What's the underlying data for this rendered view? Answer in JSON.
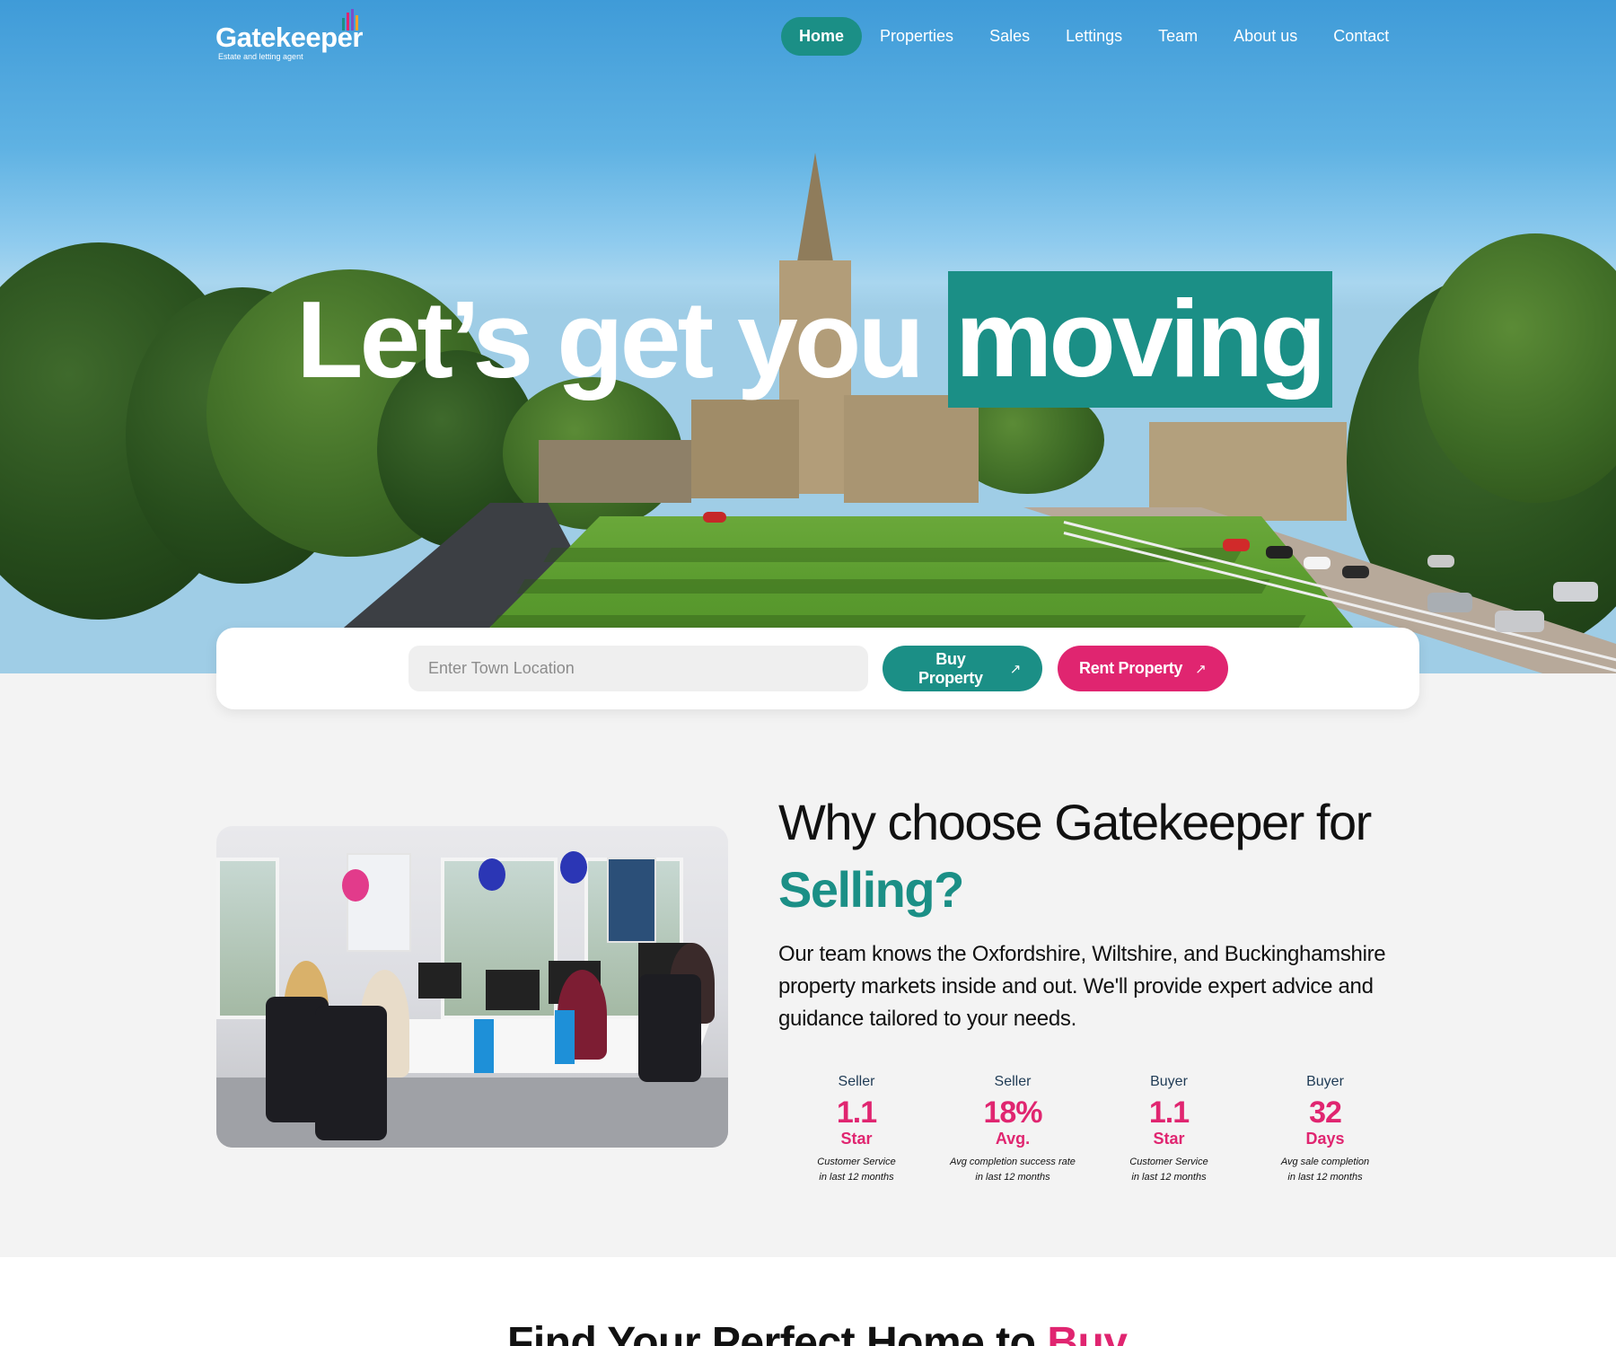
{
  "brand": {
    "name": "Gatekeeper",
    "tagline": "Estate and letting agent",
    "colors": {
      "teal": "#1b8f86",
      "pink": "#e02570"
    }
  },
  "nav": {
    "items": [
      {
        "label": "Home",
        "active": true
      },
      {
        "label": "Properties"
      },
      {
        "label": "Sales"
      },
      {
        "label": "Lettings"
      },
      {
        "label": "Team"
      },
      {
        "label": "About us"
      },
      {
        "label": "Contact"
      }
    ]
  },
  "hero": {
    "headline_plain": "Let’s get you",
    "headline_highlight": "moving"
  },
  "search": {
    "placeholder": "Enter Town Location",
    "value": "",
    "buy_label": "Buy Property",
    "rent_label": "Rent Property",
    "arrow_icon": "arrow-up-right-icon"
  },
  "why": {
    "title": "Why choose Gatekeeper for",
    "accent": "Selling?",
    "body": "Our team knows the Oxfordshire, Wiltshire, and Buckinghamshire property markets inside and out. We'll provide expert advice and guidance tailored to your needs.",
    "stats": [
      {
        "who": "Seller",
        "value": "1.1",
        "unit": "Star",
        "desc1": "Customer Service",
        "desc2": "in last 12 months"
      },
      {
        "who": "Seller",
        "value": "18%",
        "unit": "Avg.",
        "desc1": "Avg completion success rate",
        "desc2": "in last 12 months"
      },
      {
        "who": "Buyer",
        "value": "1.1",
        "unit": "Star",
        "desc1": "Customer Service",
        "desc2": "in last 12 months"
      },
      {
        "who": "Buyer",
        "value": "32",
        "unit": "Days",
        "desc1": "Avg sale completion",
        "desc2": "in last 12 months"
      }
    ]
  },
  "find": {
    "title": "Find Your Perfect Home to",
    "accent": "Buy"
  }
}
